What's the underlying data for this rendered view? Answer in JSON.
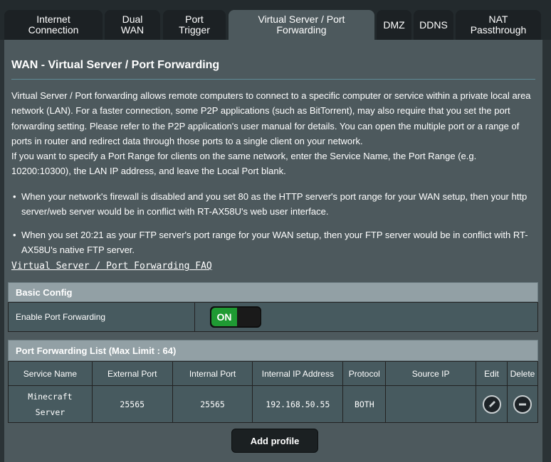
{
  "tabs": [
    {
      "label": "Internet\nConnection"
    },
    {
      "label": "Dual\nWAN"
    },
    {
      "label": "Port\nTrigger"
    },
    {
      "label": "Virtual Server / Port\nForwarding"
    },
    {
      "label": "DMZ"
    },
    {
      "label": "DDNS"
    },
    {
      "label": "NAT\nPassthrough"
    }
  ],
  "page": {
    "title": "WAN - Virtual Server / Port Forwarding",
    "description1": "Virtual Server / Port forwarding allows remote computers to connect to a specific computer or service within a private local area network (LAN). For a faster connection, some P2P applications (such as BitTorrent), may also require that you set the port forwarding setting. Please refer to the P2P application's user manual for details. You can open the multiple port or a range of ports in router and redirect data through those ports to a single client on your network.",
    "description2": "If you want to specify a Port Range for clients on the same network, enter the Service Name, the Port Range (e.g. 10200:10300), the LAN IP address, and leave the Local Port blank.",
    "bullet1": "When your network's firewall is disabled and you set 80 as the HTTP server's port range for your WAN setup, then your http server/web server would be in conflict with RT-AX58U's web user interface.",
    "bullet2": "When you set 20:21 as your FTP server's port range for your WAN setup, then your FTP server would be in conflict with RT-AX58U's native FTP server.",
    "faq_link": "Virtual Server / Port Forwarding FAQ"
  },
  "basic_config": {
    "header": "Basic Config",
    "enable_label": "Enable Port Forwarding",
    "switch_label": "ON"
  },
  "pf_list": {
    "header": "Port Forwarding List (Max Limit : 64)",
    "columns": [
      "Service Name",
      "External Port",
      "Internal Port",
      "Internal IP Address",
      "Protocol",
      "Source IP",
      "Edit",
      "Delete"
    ],
    "rows": [
      {
        "service_name": "Minecraft\nServer",
        "external_port": "25565",
        "internal_port": "25565",
        "internal_ip": "192.168.50.55",
        "protocol": "BOTH",
        "source_ip": ""
      }
    ]
  },
  "add_button": "Add profile",
  "icons": {
    "edit": "pencil-icon",
    "delete": "minus-circle-icon"
  }
}
